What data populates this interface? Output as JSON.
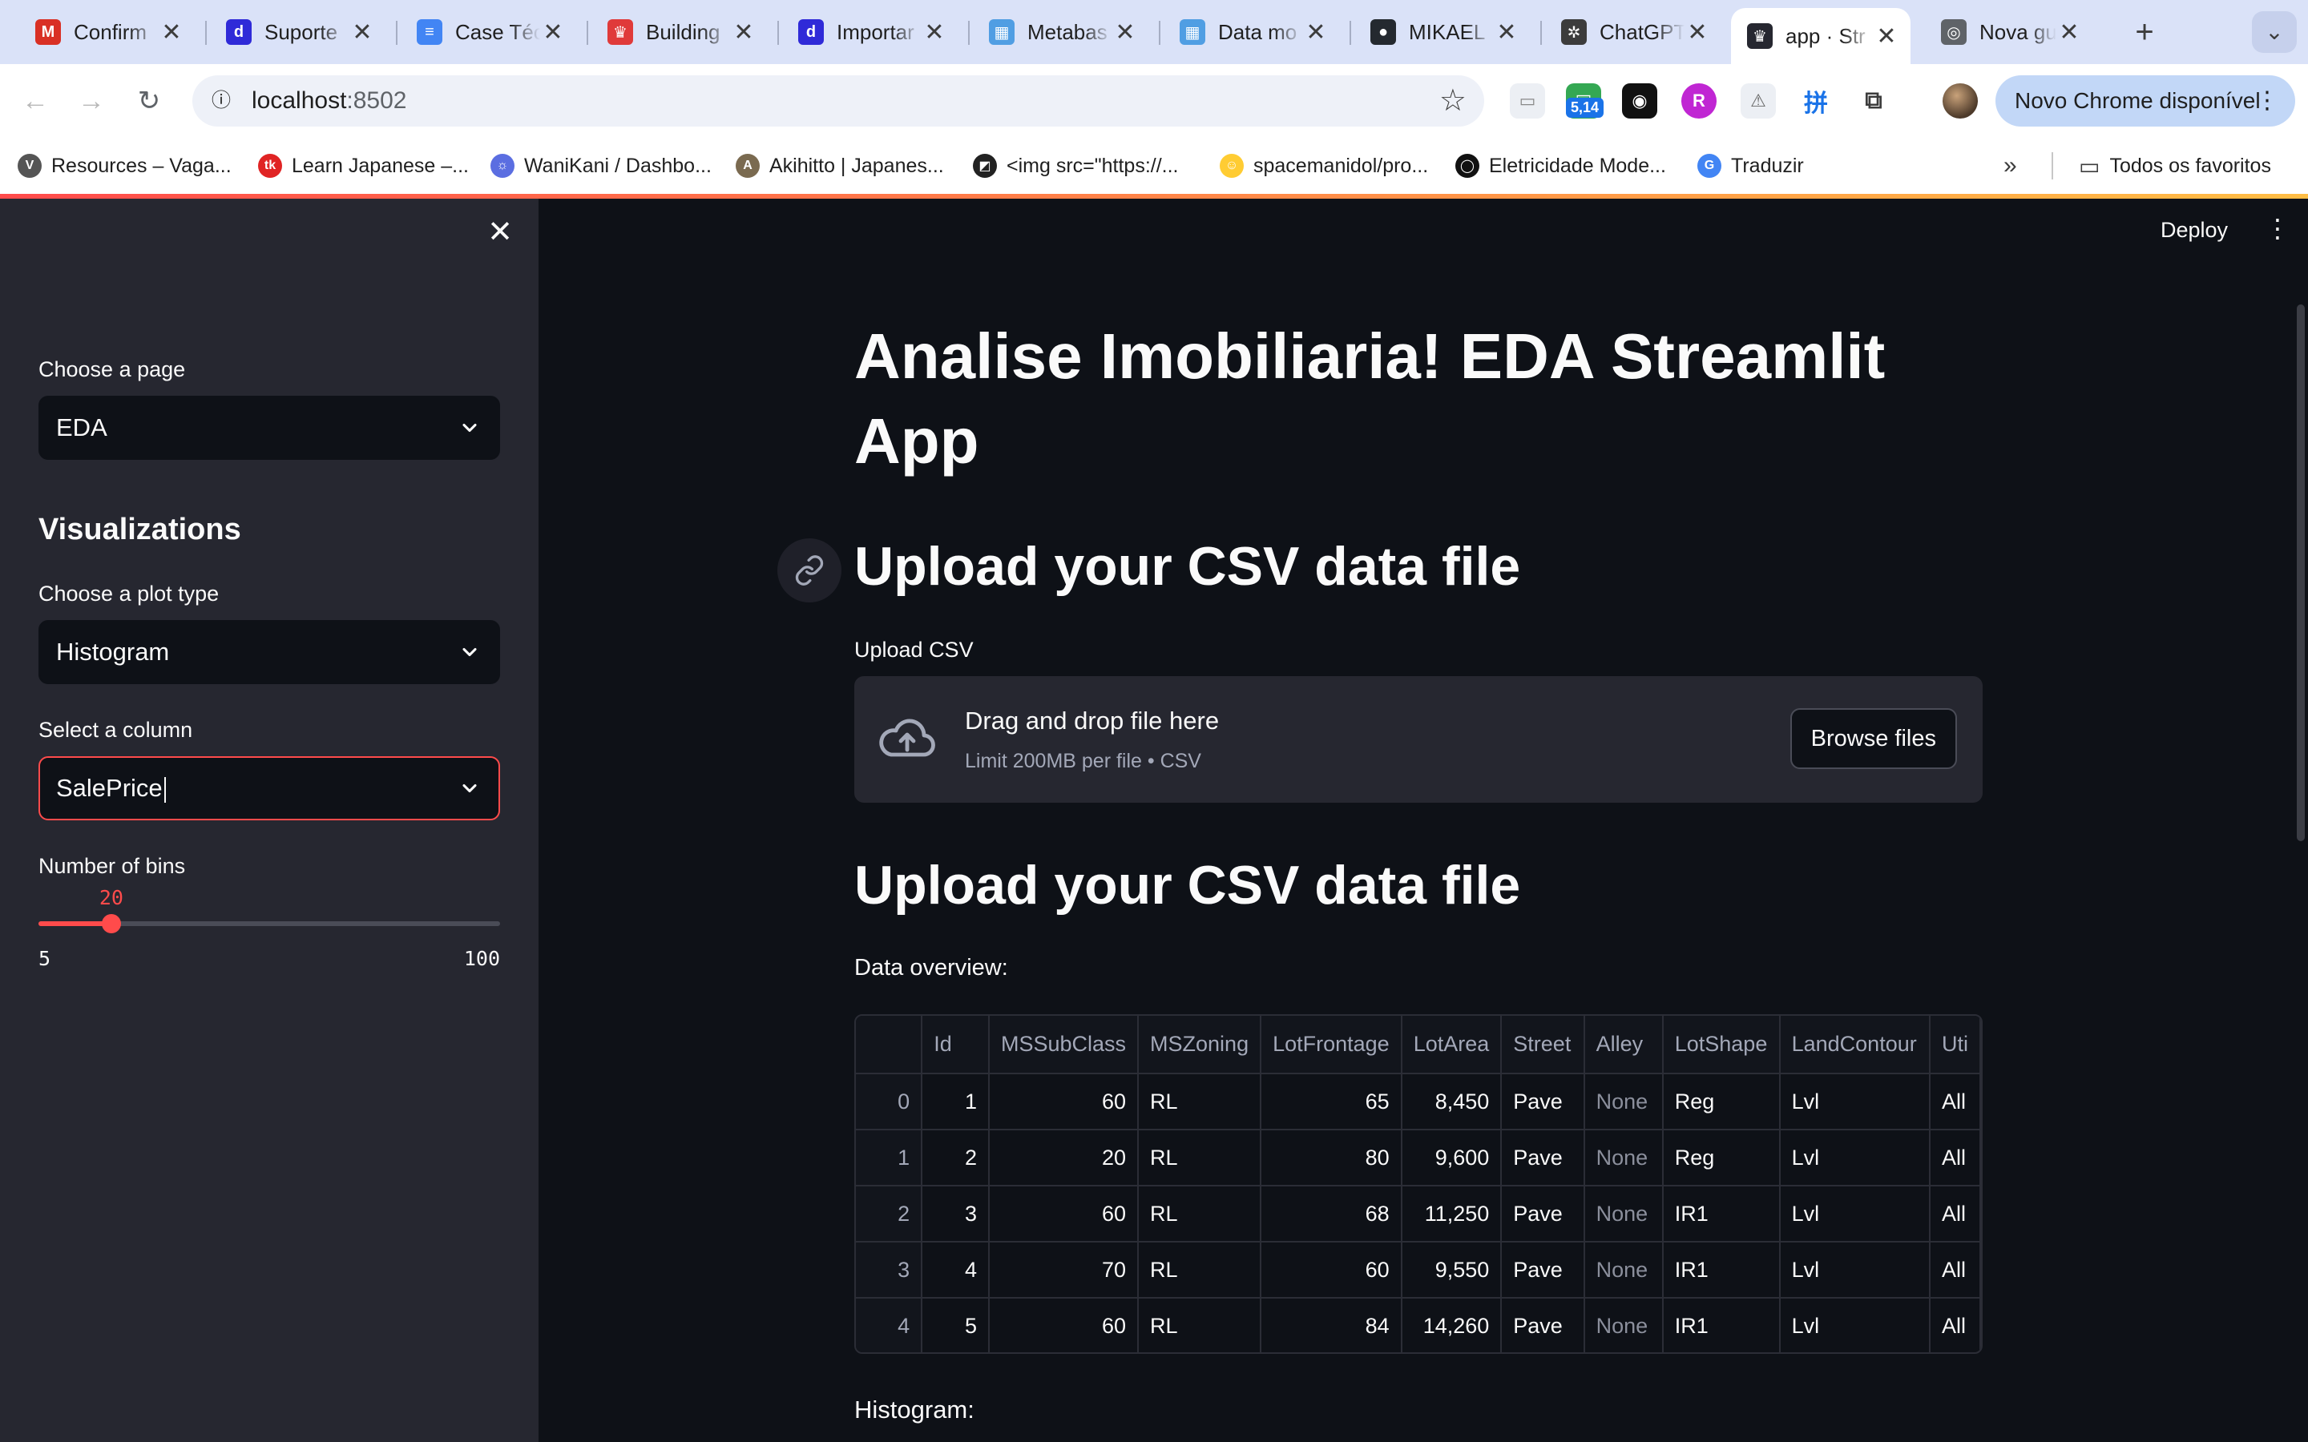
{
  "browser": {
    "tabs": [
      {
        "title": "Confirm",
        "icon": "gmail-icon",
        "color": "#d93025",
        "glyph": "M",
        "close": "✕"
      },
      {
        "title": "Suporte",
        "icon": "notion-d-icon",
        "color": "#2f2ad8",
        "glyph": "d",
        "close": "✕"
      },
      {
        "title": "Case Téc",
        "icon": "google-docs-icon",
        "color": "#4285f4",
        "glyph": "≡",
        "close": "✕"
      },
      {
        "title": "Building",
        "icon": "crown-icon",
        "color": "#e03a3a",
        "glyph": "♛",
        "close": "✕"
      },
      {
        "title": "Importar",
        "icon": "notion-d-icon",
        "color": "#2f2ad8",
        "glyph": "d",
        "close": "✕"
      },
      {
        "title": "Metabas",
        "icon": "metabase-icon",
        "color": "#509ee3",
        "glyph": "▦",
        "close": "✕"
      },
      {
        "title": "Data mo",
        "icon": "metabase-icon",
        "color": "#509ee3",
        "glyph": "▦",
        "close": "✕"
      },
      {
        "title": "MIKAEL",
        "icon": "github-icon",
        "color": "#24292f",
        "glyph": "●",
        "close": "✕"
      },
      {
        "title": "ChatGPT",
        "icon": "chatgpt-icon",
        "color": "#3c3c3c",
        "glyph": "✲",
        "close": "✕"
      },
      {
        "title": "app · Str",
        "icon": "streamlit-icon",
        "color": "#262730",
        "glyph": "♛",
        "close": "✕"
      },
      {
        "title": "Nova gu",
        "icon": "chrome-icon",
        "color": "#5f6368",
        "glyph": "◎",
        "close": "✕"
      }
    ],
    "new_tab": "+",
    "tab_search": "⌄",
    "url_host": "localhost",
    "url_port": ":8502",
    "extension_badge": "5,14",
    "update_button": "Novo Chrome disponível",
    "bookmarks": [
      {
        "label": "Resources – Vaga...",
        "icon": "vgb-icon",
        "color": "#555555",
        "glyph": "V"
      },
      {
        "label": "Learn Japanese –...",
        "icon": "tk-icon",
        "color": "#e02424",
        "glyph": "tk"
      },
      {
        "label": "WaniKani / Dashbo...",
        "icon": "wanikani-icon",
        "color": "#5b6ee1",
        "glyph": "☼"
      },
      {
        "label": "Akihitto | Japanes...",
        "icon": "akihitto-icon",
        "color": "#7a6a50",
        "glyph": "A"
      },
      {
        "label": "<img src=\"https://...",
        "icon": "image-bookmark-icon",
        "color": "#222222",
        "glyph": "◩"
      },
      {
        "label": "spacemanidol/pro...",
        "icon": "hugging-face-icon",
        "color": "#ffcc33",
        "glyph": "☺"
      },
      {
        "label": "Eletricidade Mode...",
        "icon": "circle-logo-icon",
        "color": "#111111",
        "glyph": "◯"
      },
      {
        "label": "Traduzir",
        "icon": "google-translate-icon",
        "color": "#4285f4",
        "glyph": "G"
      }
    ],
    "more_bookmarks": "»",
    "all_bookmarks": "Todos os favoritos"
  },
  "sidebar": {
    "page_label": "Choose a page",
    "page_value": "EDA",
    "section_heading": "Visualizations",
    "plot_label": "Choose a plot type",
    "plot_value": "Histogram",
    "column_label": "Select a column",
    "column_value": "SalePrice",
    "bins_label": "Number of bins",
    "bins_value": "20",
    "bins_min": "5",
    "bins_max": "100",
    "bins_fraction": 0.1579
  },
  "main": {
    "deploy": "Deploy",
    "title": "Analise Imobiliaria! EDA Streamlit App",
    "upload_heading": "Upload your CSV data file",
    "upload_label": "Upload CSV",
    "dropzone_title": "Drag and drop file here",
    "dropzone_sub": "Limit 200MB per file • CSV",
    "browse_button": "Browse files",
    "second_heading": "Upload your CSV data file",
    "overview_label": "Data overview:",
    "histogram_label": "Histogram:"
  },
  "table": {
    "columns": [
      "",
      "Id",
      "MSSubClass",
      "MSZoning",
      "LotFrontage",
      "LotArea",
      "Street",
      "Alley",
      "LotShape",
      "LandContour",
      "Uti"
    ],
    "rows": [
      [
        "0",
        "1",
        "60",
        "RL",
        "65",
        "8,450",
        "Pave",
        "None",
        "Reg",
        "Lvl",
        "All"
      ],
      [
        "1",
        "2",
        "20",
        "RL",
        "80",
        "9,600",
        "Pave",
        "None",
        "Reg",
        "Lvl",
        "All"
      ],
      [
        "2",
        "3",
        "60",
        "RL",
        "68",
        "11,250",
        "Pave",
        "None",
        "IR1",
        "Lvl",
        "All"
      ],
      [
        "3",
        "4",
        "70",
        "RL",
        "60",
        "9,550",
        "Pave",
        "None",
        "IR1",
        "Lvl",
        "All"
      ],
      [
        "4",
        "5",
        "60",
        "RL",
        "84",
        "14,260",
        "Pave",
        "None",
        "IR1",
        "Lvl",
        "All"
      ]
    ],
    "numeric_columns": [
      1,
      2,
      4,
      5
    ]
  },
  "colors": {
    "accent": "#ff4b4b",
    "background": "#0e1117",
    "sidebar": "#262730",
    "text": "#fafafa"
  }
}
